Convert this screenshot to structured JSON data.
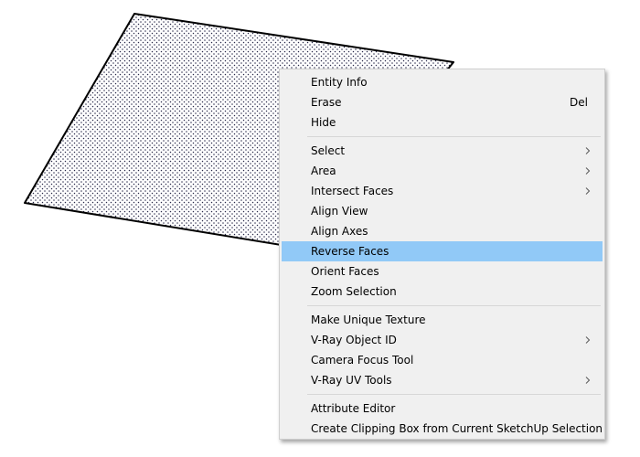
{
  "canvas": {
    "face_stroke_color": "#000000",
    "face_dot_color": "#2a2a4a"
  },
  "context_menu": {
    "groups": [
      [
        {
          "label": "Entity Info",
          "shortcut": "",
          "submenu": false
        },
        {
          "label": "Erase",
          "shortcut": "Del",
          "submenu": false
        },
        {
          "label": "Hide",
          "shortcut": "",
          "submenu": false
        }
      ],
      [
        {
          "label": "Select",
          "shortcut": "",
          "submenu": true
        },
        {
          "label": "Area",
          "shortcut": "",
          "submenu": true
        },
        {
          "label": "Intersect Faces",
          "shortcut": "",
          "submenu": true
        },
        {
          "label": "Align View",
          "shortcut": "",
          "submenu": false
        },
        {
          "label": "Align Axes",
          "shortcut": "",
          "submenu": false
        },
        {
          "label": "Reverse Faces",
          "shortcut": "",
          "submenu": false,
          "highlighted": true
        },
        {
          "label": "Orient Faces",
          "shortcut": "",
          "submenu": false
        },
        {
          "label": "Zoom Selection",
          "shortcut": "",
          "submenu": false
        }
      ],
      [
        {
          "label": "Make Unique Texture",
          "shortcut": "",
          "submenu": false
        },
        {
          "label": "V-Ray Object ID",
          "shortcut": "",
          "submenu": true
        },
        {
          "label": "Camera Focus Tool",
          "shortcut": "",
          "submenu": false
        },
        {
          "label": "V-Ray UV Tools",
          "shortcut": "",
          "submenu": true
        }
      ],
      [
        {
          "label": "Attribute Editor",
          "shortcut": "",
          "submenu": false
        },
        {
          "label": "Create Clipping Box from Current SketchUp Selection",
          "shortcut": "",
          "submenu": false
        }
      ]
    ],
    "highlight_color": "#91c9f7",
    "background_color": "#f0f0f0"
  }
}
